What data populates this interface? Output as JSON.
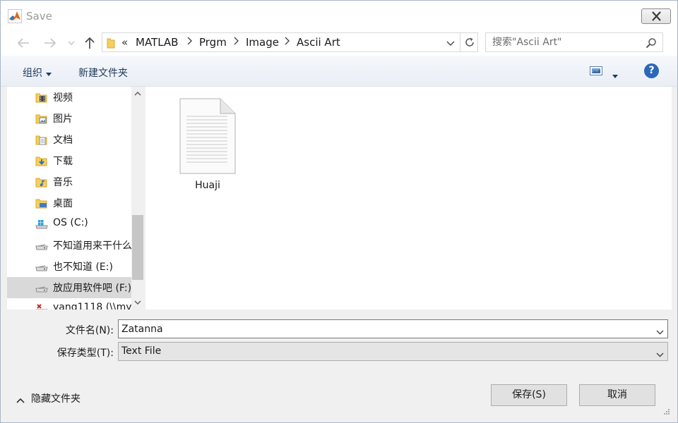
{
  "window": {
    "title": "Save"
  },
  "address": {
    "overflow": "«",
    "crumbs": [
      "MATLAB",
      "Prgm",
      "Image",
      "Ascii Art"
    ]
  },
  "search": {
    "placeholder": "搜索\"Ascii Art\""
  },
  "toolbar": {
    "organize": "组织",
    "new_folder": "新建文件夹",
    "help": "?"
  },
  "nav": {
    "items": [
      {
        "label": "视频",
        "icon": "videos-folder-icon"
      },
      {
        "label": "图片",
        "icon": "pictures-folder-icon"
      },
      {
        "label": "文档",
        "icon": "documents-folder-icon"
      },
      {
        "label": "下载",
        "icon": "downloads-folder-icon"
      },
      {
        "label": "音乐",
        "icon": "music-folder-icon"
      },
      {
        "label": "桌面",
        "icon": "desktop-folder-icon"
      },
      {
        "label": "OS (C:)",
        "icon": "windows-drive-icon"
      },
      {
        "label": "不知道用来干什么",
        "icon": "drive-icon"
      },
      {
        "label": "也不知道 (E:)",
        "icon": "drive-icon"
      },
      {
        "label": "放应用软件吧 (F:)",
        "icon": "drive-icon",
        "selected": true
      },
      {
        "label": "yang1118 (\\\\my",
        "icon": "network-drive-icon"
      }
    ]
  },
  "files": [
    {
      "name": "Huaji",
      "icon": "text-document-icon"
    }
  ],
  "form": {
    "filename_label": "文件名(N):",
    "filename_value": "Zatanna",
    "filetype_label": "保存类型(T):",
    "filetype_value": "Text File"
  },
  "footer": {
    "hide_folders": "隐藏文件夹",
    "save": "保存(S)",
    "cancel": "取消"
  },
  "colors": {
    "help_blue": "#2b68b7",
    "folder_yellow": "#f6cf5a",
    "toolbar_text": "#1e395b"
  }
}
